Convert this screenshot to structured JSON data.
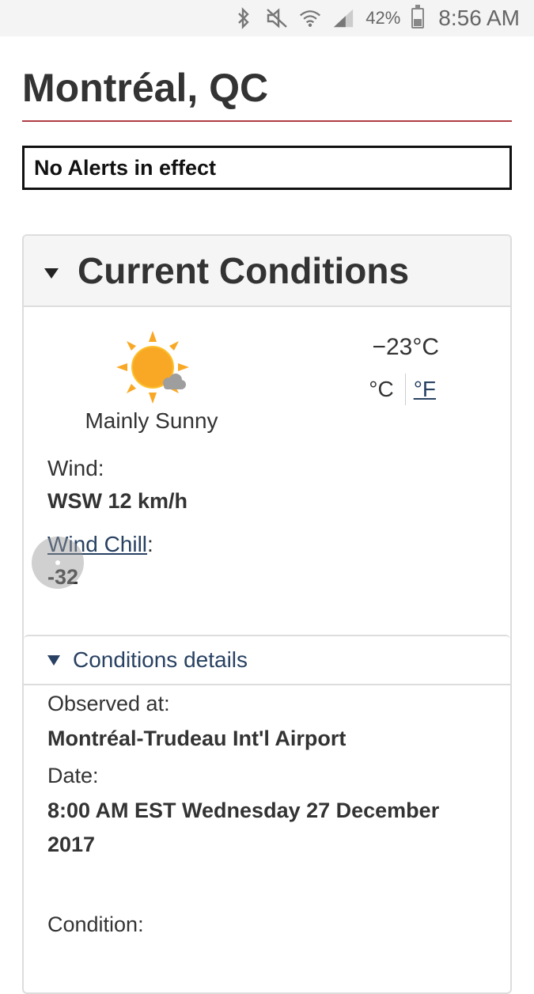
{
  "status_bar": {
    "battery_percent": "42%",
    "time": "8:56 AM",
    "icons": [
      "bluetooth-icon",
      "mute-icon",
      "wifi-icon",
      "signal-icon",
      "battery-icon"
    ],
    "battery_level": 0.42
  },
  "header": {
    "title": "Montréal, QC",
    "rule_color": "#af3c43"
  },
  "alert": {
    "text": "No Alerts in effect"
  },
  "current_conditions": {
    "title": "Current Conditions",
    "icon": "mainly-sunny-icon",
    "condition": "Mainly Sunny",
    "temperature": "−23°C",
    "unit_c": "°C",
    "unit_f": "°F",
    "wind_label": "Wind:",
    "wind_value": "WSW 12 km/h",
    "wind_chill_link": "Wind Chill",
    "wind_chill_colon": ":",
    "wind_chill_value": "-32"
  },
  "details": {
    "title": "Conditions details",
    "observed_label": "Observed at:",
    "observed_value": "Montréal-Trudeau Int'l Airport",
    "date_label": "Date:",
    "date_value": "8:00 AM EST Wednesday 27 December 2017",
    "condition_label": "Condition:"
  },
  "colors": {
    "link": "#284162",
    "accent_rule": "#af3c43",
    "sun": "#f9a825"
  }
}
